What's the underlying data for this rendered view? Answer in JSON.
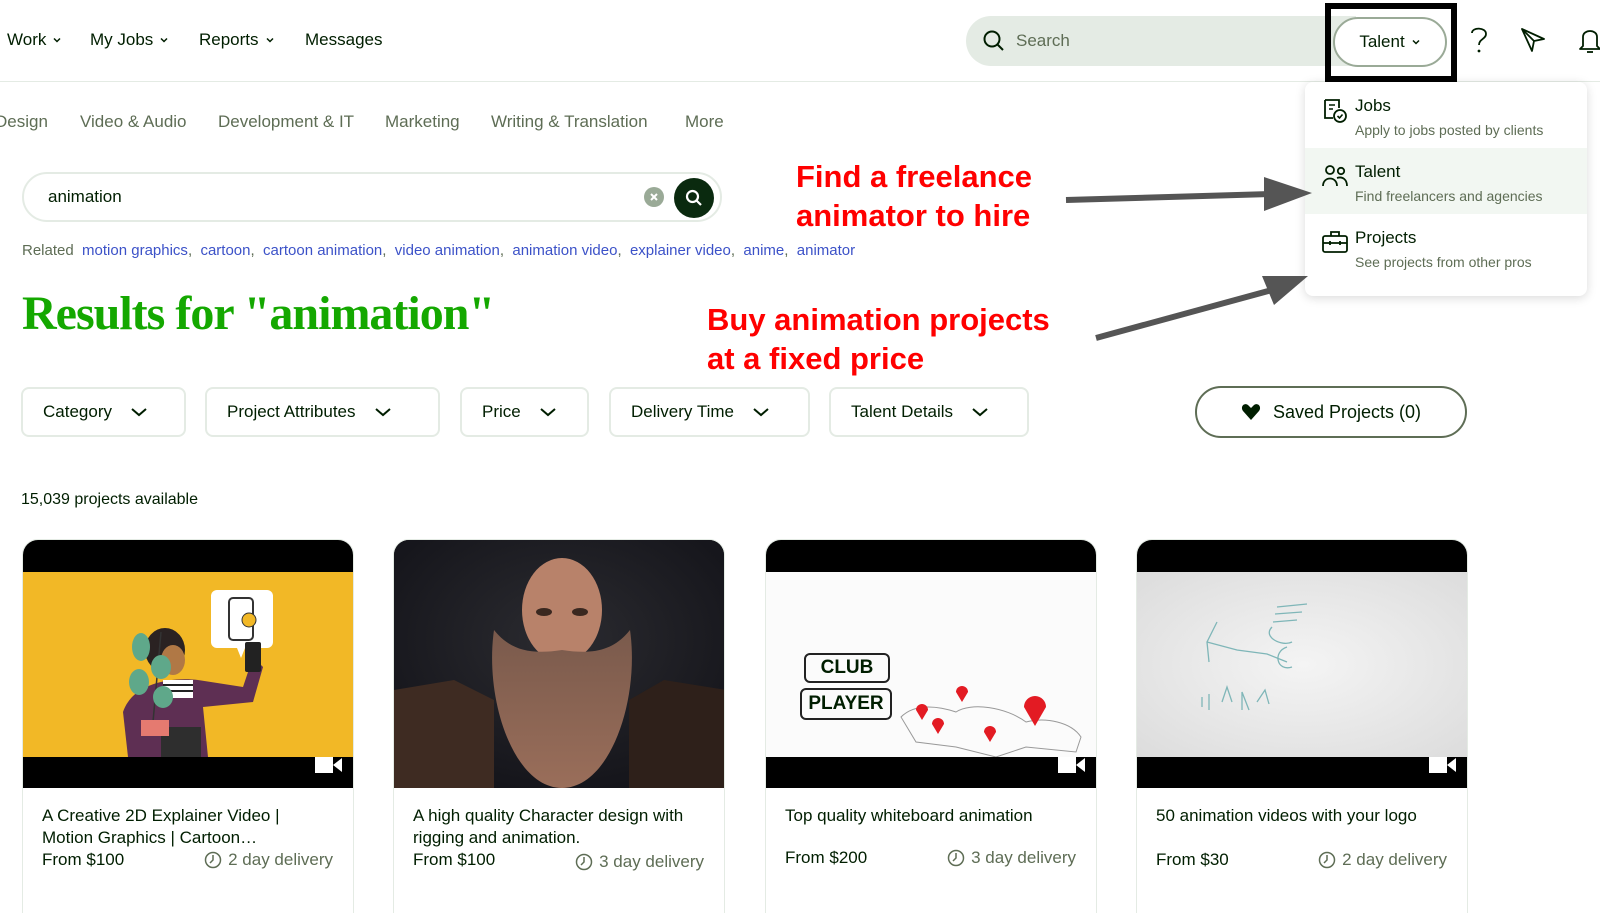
{
  "topnav": {
    "items": [
      {
        "label": "Work",
        "has_dropdown": true
      },
      {
        "label": "My Jobs",
        "has_dropdown": true
      },
      {
        "label": "Reports",
        "has_dropdown": true
      },
      {
        "label": "Messages",
        "has_dropdown": false
      }
    ],
    "search_placeholder": "Search",
    "search_type_label": "Talent",
    "icons": [
      "help-icon",
      "send-icon",
      "bell-icon"
    ]
  },
  "search_type_dropdown": {
    "items": [
      {
        "title": "Jobs",
        "description": "Apply to jobs posted by clients",
        "icon": "jobs-icon",
        "active": false
      },
      {
        "title": "Talent",
        "description": "Find freelancers and agencies",
        "icon": "people-icon",
        "active": true
      },
      {
        "title": "Projects",
        "description": "See projects from other pros",
        "icon": "briefcase-icon",
        "active": false
      }
    ]
  },
  "categories": [
    "Design",
    "Video & Audio",
    "Development & IT",
    "Marketing",
    "Writing & Translation",
    "More"
  ],
  "search": {
    "value": "animation"
  },
  "related": {
    "label": "Related",
    "terms": [
      "motion graphics",
      "cartoon",
      "cartoon animation",
      "video animation",
      "animation video",
      "explainer video",
      "anime",
      "animator"
    ]
  },
  "results_title": "Results for \"animation\"",
  "annotations": {
    "talent_note_line1": "Find a freelance",
    "talent_note_line2": "animator to hire",
    "projects_note_line1": "Buy animation projects",
    "projects_note_line2": "at a fixed price",
    "color": "#ff0000"
  },
  "filters": [
    "Category",
    "Project Attributes",
    "Price",
    "Delivery Time",
    "Talent Details"
  ],
  "saved_projects_label": "Saved Projects (0)",
  "projects_count": "15,039 projects available",
  "projects": [
    {
      "title": "A Creative 2D Explainer Video | Motion Graphics | Cartoon…",
      "price": "From $100",
      "delivery": "2 day delivery",
      "thumbnail": "illustration-woman-phone"
    },
    {
      "title": "A high quality Character design with rigging and animation.",
      "price": "From $100",
      "delivery": "3 day delivery",
      "thumbnail": "3d-dwarf-character"
    },
    {
      "title": "Top quality whiteboard animation",
      "price": "From $200",
      "delivery": "3 day delivery",
      "thumbnail": "whiteboard-world-map",
      "thumb_text": [
        "CLUB",
        "PLAYER"
      ]
    },
    {
      "title": "50 animation videos with your logo",
      "price": "From $30",
      "delivery": "2 day delivery",
      "thumbnail": "logo-sketch"
    }
  ],
  "colors": {
    "brand_green": "#14a800",
    "dark_green": "#001e00",
    "link_blue": "#3c52c8",
    "muted": "#5e6d55"
  }
}
